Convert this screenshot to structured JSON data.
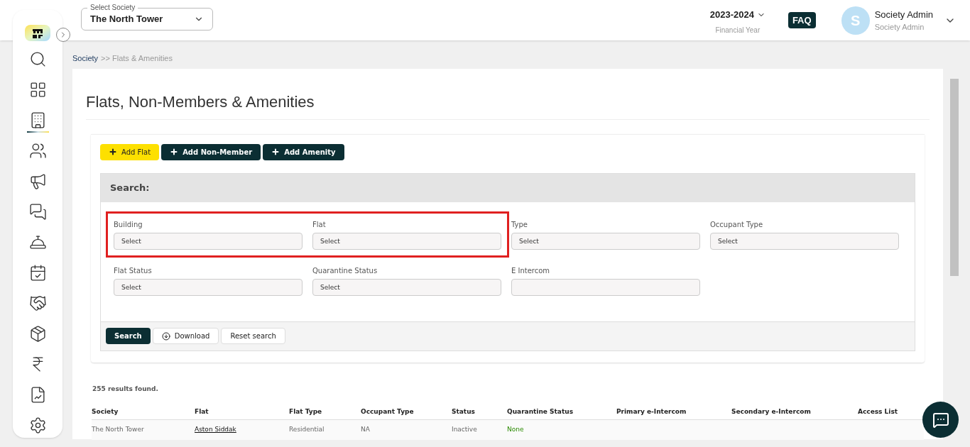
{
  "header": {
    "society_select": {
      "label": "Select Society",
      "value": "The North Tower"
    },
    "year": {
      "value": "2023-2024",
      "caption": "Financial Year"
    },
    "faq": "FAQ",
    "user": {
      "initial": "S",
      "name": "Society Admin",
      "role": "Society Admin"
    }
  },
  "sidebar": {
    "items": [
      {
        "kind": "search",
        "selected": false
      },
      {
        "kind": "dashboard",
        "selected": false
      },
      {
        "kind": "building",
        "selected": true
      },
      {
        "kind": "members",
        "selected": false
      },
      {
        "kind": "announce",
        "selected": false
      },
      {
        "kind": "chat",
        "selected": false
      },
      {
        "kind": "desk",
        "selected": false
      },
      {
        "kind": "calendar",
        "selected": false
      },
      {
        "kind": "handshake",
        "selected": false
      },
      {
        "kind": "box",
        "selected": false
      },
      {
        "kind": "rupee",
        "selected": false
      },
      {
        "kind": "report",
        "selected": false
      },
      {
        "kind": "settings",
        "selected": false
      }
    ]
  },
  "breadcrumb": [
    "Society",
    ">> Flats & Amenities"
  ],
  "page_title": "Flats, Non-Members & Amenities",
  "actions": [
    {
      "label": "Add Flat",
      "kind": "primary"
    },
    {
      "label": "Add Non-Member",
      "kind": "dark"
    },
    {
      "label": "Add Amenity",
      "kind": "dark"
    }
  ],
  "search": {
    "heading": "Search:",
    "filter_groups": [
      {
        "highlighted": true,
        "filters": [
          {
            "label": "Building",
            "placeholder": "Select"
          },
          {
            "label": "Flat",
            "placeholder": "Select"
          }
        ]
      },
      {
        "highlighted": false,
        "filters": [
          {
            "label": "Type",
            "placeholder": "Select"
          },
          {
            "label": "Occupant Type",
            "placeholder": "Select"
          }
        ]
      },
      {
        "highlighted": false,
        "filters": [
          {
            "label": "Flat Status",
            "placeholder": "Select"
          },
          {
            "label": "Quarantine Status",
            "placeholder": "Select"
          },
          {
            "label": "E Intercom"
          }
        ]
      }
    ],
    "buttons": [
      {
        "label": "Search",
        "kind": "dark"
      },
      {
        "label": "Download",
        "kind": "download"
      },
      {
        "label": "Reset search",
        "kind": "plain"
      }
    ]
  },
  "results": {
    "count": "255 results found.",
    "columns": [
      "Society",
      "Flat",
      "Flat Type",
      "Occupant Type",
      "Status",
      "Quarantine Status",
      "Primary e-Intercom",
      "Secondary e-Intercom",
      "Access List"
    ],
    "rows": [
      [
        {
          "text": "The North Tower",
          "kind": "text"
        },
        {
          "text": "Aston Siddak",
          "kind": "link"
        },
        {
          "text": "Residential",
          "kind": "text"
        },
        {
          "text": "NA",
          "kind": "text"
        },
        {
          "text": "Inactive",
          "kind": "text"
        },
        {
          "text": "None",
          "kind": "ok"
        }
      ]
    ]
  }
}
